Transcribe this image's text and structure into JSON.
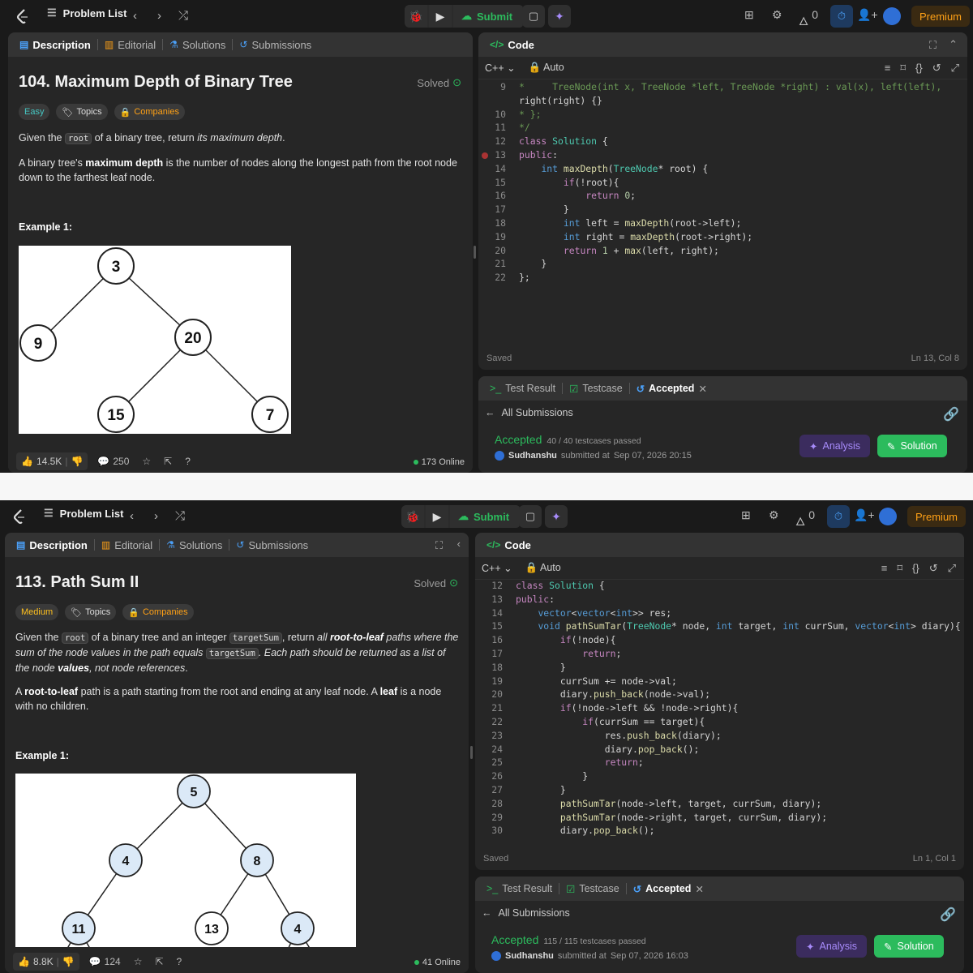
{
  "topbar": {
    "problem_list": "Problem List",
    "submit": "Submit",
    "streak": "0",
    "premium": "Premium"
  },
  "tabs": {
    "description": "Description",
    "editorial": "Editorial",
    "solutions": "Solutions",
    "submissions": "Submissions",
    "code": "Code"
  },
  "labels": {
    "solved": "Solved",
    "topics": "Topics",
    "companies": "Companies",
    "example": "Example 1:",
    "lang": "C++",
    "auto": "Auto",
    "saved": "Saved",
    "test_result": "Test Result",
    "testcase": "Testcase",
    "accepted_tab": "Accepted",
    "all_submissions": "All Submissions",
    "accepted": "Accepted",
    "analysis": "Analysis",
    "solution": "Solution",
    "submitted_at": "submitted at"
  },
  "shot1": {
    "title": "104. Maximum Depth of Binary Tree",
    "difficulty": "Easy",
    "desc_p1": "Given the <code>root</code> of a binary tree, return <i>its maximum depth</i>.",
    "desc_p2": "A binary tree's <b>maximum depth</b> is the number of nodes along the longest path from the root node down to the farthest leaf node.",
    "tree_nodes": [
      "3",
      "9",
      "20",
      "15",
      "7"
    ],
    "likes": "14.5K",
    "comments": "250",
    "online": "173 Online",
    "cursor": "Ln 13, Col 8",
    "code": [
      {
        "n": "9",
        "t": "*     TreeNode(int x, TreeNode *left, TreeNode *right) : val(x), left(left),"
      },
      {
        "n": "",
        "t": "right(right) {}"
      },
      {
        "n": "10",
        "t": "* };"
      },
      {
        "n": "11",
        "t": "*/"
      },
      {
        "n": "12",
        "t": "class Solution {"
      },
      {
        "n": "13",
        "t": "public:"
      },
      {
        "n": "14",
        "t": "    int maxDepth(TreeNode* root) {"
      },
      {
        "n": "15",
        "t": "        if(!root){"
      },
      {
        "n": "16",
        "t": "            return 0;"
      },
      {
        "n": "17",
        "t": "        }"
      },
      {
        "n": "18",
        "t": "        int left = maxDepth(root->left);"
      },
      {
        "n": "19",
        "t": "        int right = maxDepth(root->right);"
      },
      {
        "n": "20",
        "t": "        return 1 + max(left, right);"
      },
      {
        "n": "21",
        "t": "    }"
      },
      {
        "n": "22",
        "t": "};"
      }
    ],
    "passed": "40 / 40 testcases passed",
    "user": "Sudhanshu",
    "date": "Sep 07, 2026 20:15"
  },
  "shot2": {
    "title": "113. Path Sum II",
    "difficulty": "Medium",
    "desc_p1": "Given the <code>root</code> of a binary tree and an integer <code>targetSum</code>, return <i>all <b>root-to-leaf</b> paths where the sum of the node values in the path equals</i> <code>targetSum</code><i>. Each path should be returned as a list of the node <b>values</b>, not node references</i>.",
    "desc_p2": "A <b>root-to-leaf</b> path is a path starting from the root and ending at any leaf node. A <b>leaf</b> is a node with no children.",
    "tree_nodes": [
      "5",
      "4",
      "8",
      "11",
      "13",
      "4"
    ],
    "likes": "8.8K",
    "comments": "124",
    "online": "41 Online",
    "cursor": "Ln 1, Col 1",
    "code": [
      {
        "n": "12",
        "t": "class Solution {"
      },
      {
        "n": "13",
        "t": "public:"
      },
      {
        "n": "14",
        "t": "    vector<vector<int>> res;"
      },
      {
        "n": "15",
        "t": "    void pathSumTar(TreeNode* node, int target, int currSum, vector<int> diary){"
      },
      {
        "n": "16",
        "t": "        if(!node){"
      },
      {
        "n": "17",
        "t": "            return;"
      },
      {
        "n": "18",
        "t": "        }"
      },
      {
        "n": "19",
        "t": "        currSum += node->val;"
      },
      {
        "n": "20",
        "t": "        diary.push_back(node->val);"
      },
      {
        "n": "21",
        "t": "        if(!node->left && !node->right){"
      },
      {
        "n": "22",
        "t": "            if(currSum == target){"
      },
      {
        "n": "23",
        "t": "                res.push_back(diary);"
      },
      {
        "n": "24",
        "t": "                diary.pop_back();"
      },
      {
        "n": "25",
        "t": "                return;"
      },
      {
        "n": "26",
        "t": "            }"
      },
      {
        "n": "27",
        "t": "        }"
      },
      {
        "n": "28",
        "t": "        pathSumTar(node->left, target, currSum, diary);"
      },
      {
        "n": "29",
        "t": "        pathSumTar(node->right, target, currSum, diary);"
      },
      {
        "n": "30",
        "t": "        diary.pop_back();"
      }
    ],
    "passed": "115 / 115 testcases passed",
    "user": "Sudhanshu",
    "date": "Sep 07, 2026 16:03"
  },
  "colors": {
    "accent_green": "#2cbb5d",
    "premium_orange": "#ffa116",
    "easy": "#46c6c2",
    "medium": "#ffc01e",
    "tree_node_fill_2": "#dbe9f7"
  }
}
